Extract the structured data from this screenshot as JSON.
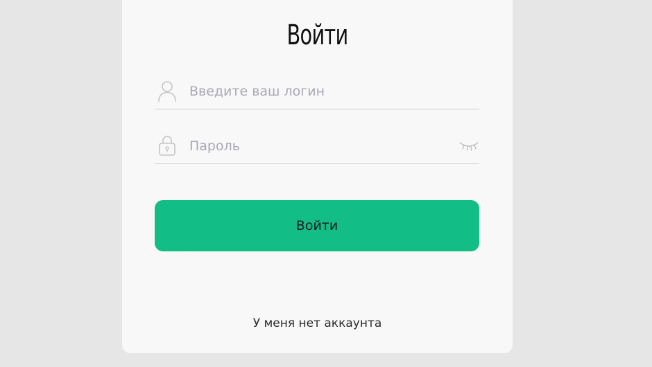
{
  "login_form": {
    "title": "Войти",
    "login_field": {
      "placeholder": "Введите ваш логин",
      "value": "",
      "icon": "user-icon"
    },
    "password_field": {
      "placeholder": "Пароль",
      "value": "",
      "icon": "lock-icon",
      "toggle_icon": "eye-closed-icon"
    },
    "submit_label": "Войти",
    "no_account_link": "У меня нет аккаунта"
  },
  "colors": {
    "page_background": "#e6e6e6",
    "card_background": "#f8f8f8",
    "accent": "#13bd86",
    "placeholder": "#a9a7b6",
    "divider": "#cfcfcf"
  }
}
